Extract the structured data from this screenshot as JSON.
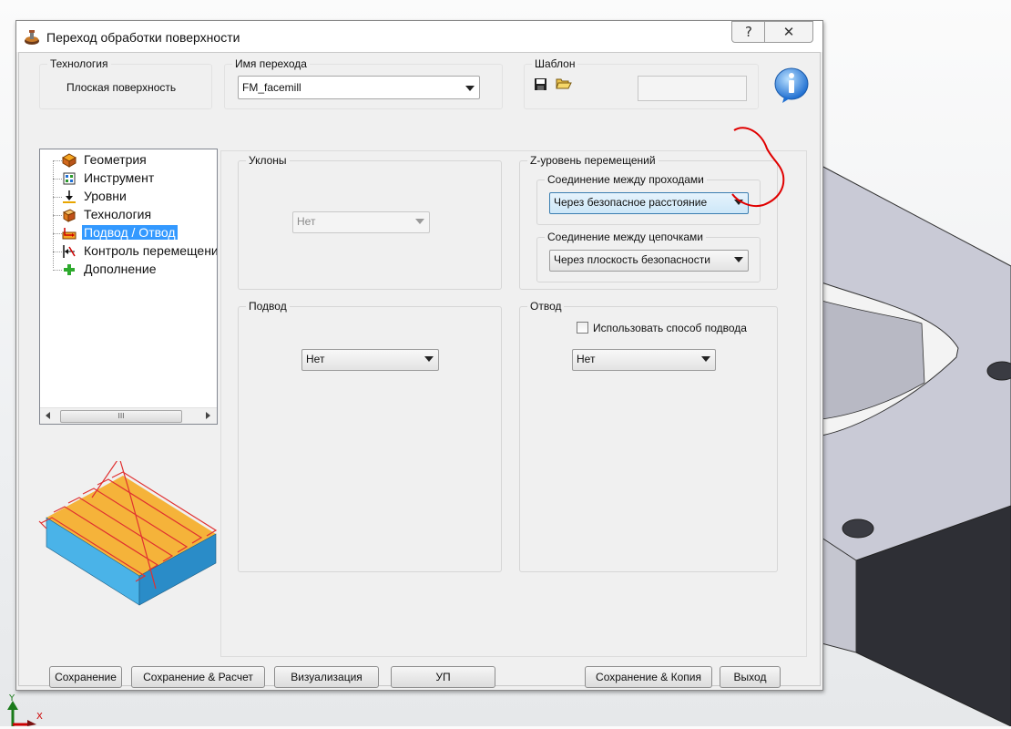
{
  "dialog": {
    "title": "Переход обработки поверхности",
    "help_glyph": "?",
    "close_glyph": "✕"
  },
  "technology": {
    "label": "Технология",
    "value": "Плоская поверхность"
  },
  "step_name": {
    "label": "Имя перехода",
    "value": "FM_facemill"
  },
  "template": {
    "label": "Шаблон",
    "save_icon": "save-icon",
    "open_icon": "open-folder-icon",
    "value": ""
  },
  "info_icon": "info-icon",
  "tree": {
    "items": [
      {
        "label": "Геометрия",
        "icon": "geometry-icon"
      },
      {
        "label": "Инструмент",
        "icon": "tool-icon"
      },
      {
        "label": "Уровни",
        "icon": "levels-icon"
      },
      {
        "label": "Технология",
        "icon": "technology-icon"
      },
      {
        "label": "Подвод / Отвод",
        "icon": "lead-in-out-icon"
      },
      {
        "label": "Контроль перемещений",
        "icon": "motion-control-icon"
      },
      {
        "label": "Дополнение",
        "icon": "plus-icon"
      }
    ],
    "selected_index": 4,
    "scroll_thumb": "III"
  },
  "slopes": {
    "label": "Уклоны",
    "value": "Нет"
  },
  "z_level": {
    "label": "Z-уровень перемещений",
    "between_passes": {
      "label": "Соединение между проходами",
      "value": "Через безопасное расстояние"
    },
    "between_chains": {
      "label": "Соединение между цепочками",
      "value": "Через плоскость безопасности"
    }
  },
  "approach": {
    "label": "Подвод",
    "value": "Нет"
  },
  "retract": {
    "label": "Отвод",
    "use_approach_label": "Использовать способ подвода",
    "use_approach_checked": false,
    "value": "Нет"
  },
  "buttons": {
    "save": "Сохранение",
    "save_calc": "Сохранение & Расчет",
    "visualize": "Визуализация",
    "nc": "УП",
    "save_copy": "Сохранение & Копия",
    "exit": "Выход"
  },
  "axes": {
    "y": "Y",
    "x": "X"
  },
  "colors": {
    "selection": "#3399ff",
    "annotation": "#e00000",
    "part": "#c9cad6"
  }
}
